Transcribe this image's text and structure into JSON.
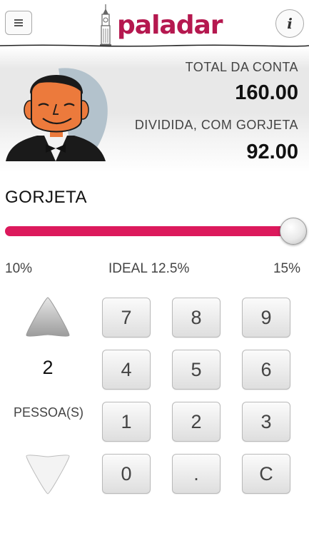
{
  "header": {
    "logo_text": "paladar",
    "menu_icon": "hamburger-icon",
    "info_label": "i"
  },
  "summary": {
    "total_label": "TOTAL DA CONTA",
    "total_value": "160.00",
    "split_label": "DIVIDIDA, COM GORJETA",
    "split_value": "92.00"
  },
  "tip": {
    "title": "GORJETA",
    "min_label": "10%",
    "ideal_label": "IDEAL 12.5%",
    "max_label": "15%",
    "value_fraction": 1.0,
    "track_color": "#dc195c"
  },
  "people": {
    "count": "2",
    "label": "PESSOA(S)",
    "up_icon": "arrow-up-icon",
    "down_icon": "arrow-down-icon"
  },
  "keypad": {
    "k7": "7",
    "k8": "8",
    "k9": "9",
    "k4": "4",
    "k5": "5",
    "k6": "6",
    "k1": "1",
    "k2": "2",
    "k3": "3",
    "k0": "0",
    "kdot": ".",
    "kclear": "C"
  }
}
